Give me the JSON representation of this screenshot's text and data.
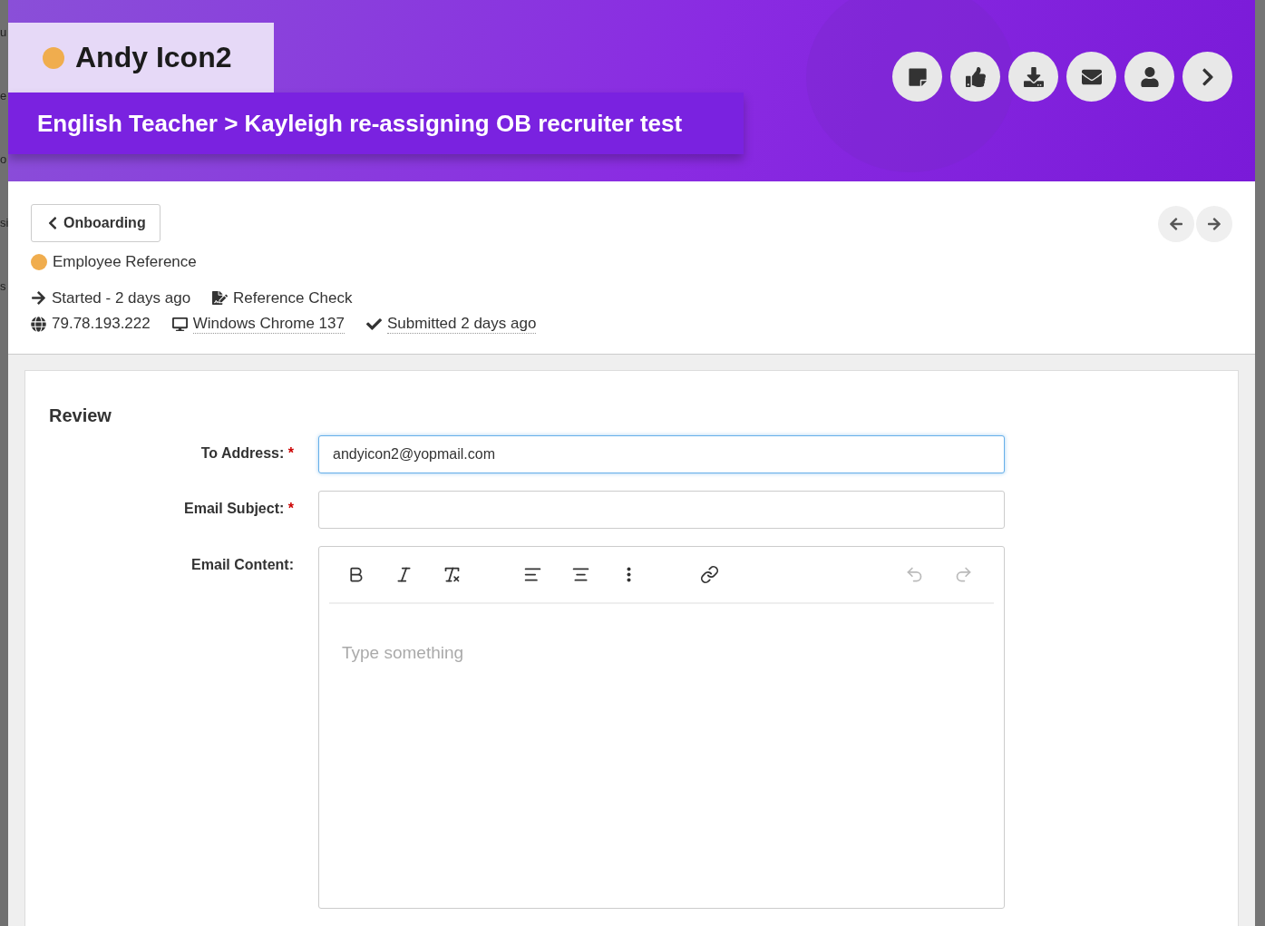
{
  "background_fragments": [
    "u",
    "e",
    "o",
    "si",
    "s"
  ],
  "header": {
    "name": "Andy Icon2",
    "breadcrumb": "English Teacher > Kayleigh re-assigning OB recruiter test",
    "actions": [
      {
        "kind": "note"
      },
      {
        "kind": "thumbs-up"
      },
      {
        "kind": "download"
      },
      {
        "kind": "email"
      },
      {
        "kind": "user"
      },
      {
        "kind": "next"
      }
    ]
  },
  "back_button": {
    "label": "Onboarding"
  },
  "stage": {
    "label": "Employee Reference",
    "color": "#f0ad4e"
  },
  "meta_rows": [
    [
      {
        "kind": "arrow",
        "text": "Started - 2 days ago",
        "dotted": false
      },
      {
        "kind": "signature",
        "text": "Reference Check",
        "dotted": false
      }
    ],
    [
      {
        "kind": "globe",
        "text": "79.78.193.222",
        "dotted": false
      },
      {
        "kind": "desktop",
        "text": "Windows Chrome 137",
        "dotted": true
      },
      {
        "kind": "check",
        "text": "Submitted 2 days ago",
        "dotted": true
      }
    ]
  ],
  "review": {
    "title": "Review",
    "fields": [
      {
        "kind": "input",
        "label": "To Address:",
        "required_mark": "*",
        "value": "andyicon2@yopmail.com",
        "focused": true
      },
      {
        "kind": "input",
        "label": "Email Subject:",
        "required_mark": "*",
        "focused": false
      },
      {
        "kind": "editor",
        "label": "Email Content:",
        "placeholder": "Type something"
      }
    ],
    "toolbar": [
      {
        "kind": "bold",
        "disabled": false
      },
      {
        "kind": "italic",
        "disabled": false
      },
      {
        "kind": "clear-format",
        "disabled": false
      },
      {
        "kind": "align-left",
        "disabled": false
      },
      {
        "kind": "align-center",
        "disabled": false
      },
      {
        "kind": "more",
        "disabled": false
      },
      {
        "kind": "link",
        "disabled": false
      },
      {
        "kind": "undo",
        "disabled": true
      },
      {
        "kind": "redo",
        "disabled": true
      }
    ]
  }
}
